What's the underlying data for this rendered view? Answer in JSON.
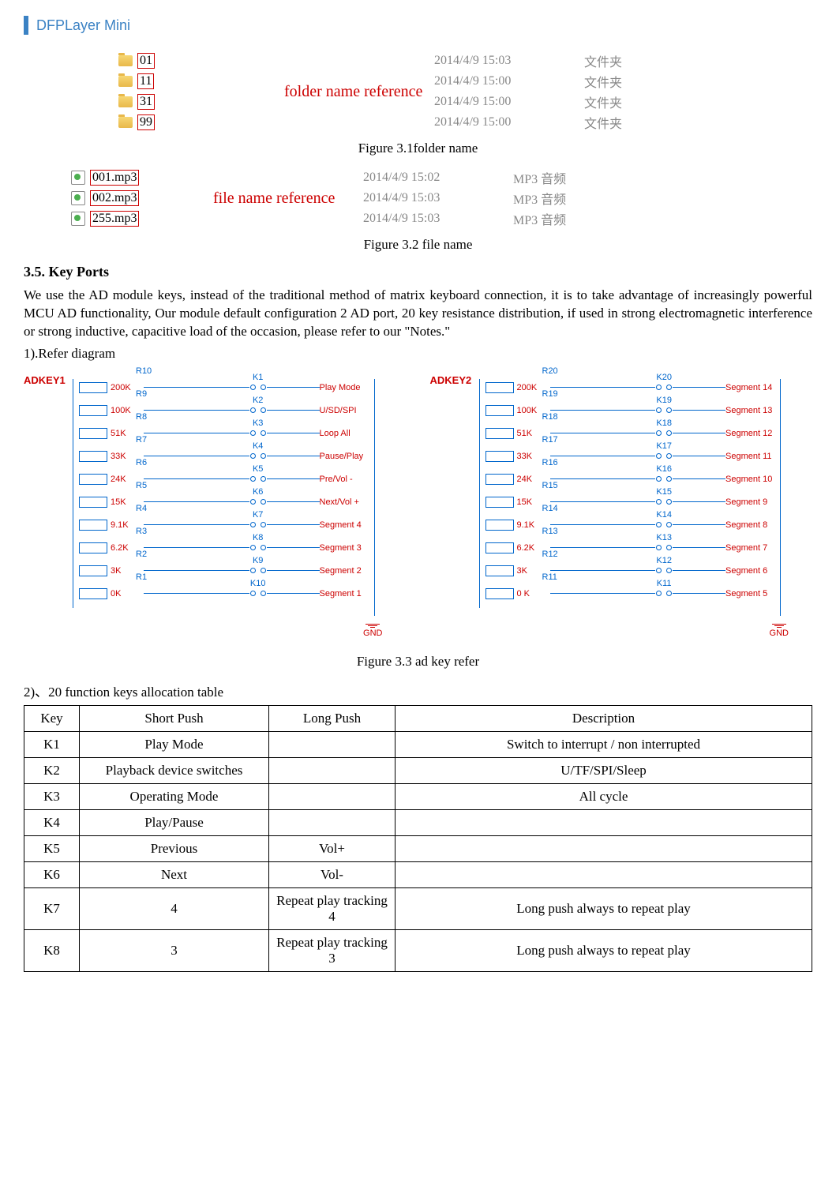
{
  "header": {
    "title": "DFPLayer Mini"
  },
  "folders": {
    "label": "folder name reference",
    "rows": [
      {
        "name": "01",
        "date": "2014/4/9 15:03",
        "type": "文件夹"
      },
      {
        "name": "11",
        "date": "2014/4/9 15:00",
        "type": "文件夹"
      },
      {
        "name": "31",
        "date": "2014/4/9 15:00",
        "type": "文件夹"
      },
      {
        "name": "99",
        "date": "2014/4/9 15:00",
        "type": "文件夹"
      }
    ],
    "caption": "Figure 3.1folder name"
  },
  "files": {
    "label": "file name reference",
    "rows": [
      {
        "name": "001.mp3",
        "date": "2014/4/9 15:02",
        "type": "MP3 音频"
      },
      {
        "name": "002.mp3",
        "date": "2014/4/9 15:03",
        "type": "MP3 音频"
      },
      {
        "name": "255.mp3",
        "date": "2014/4/9 15:03",
        "type": "MP3 音频"
      }
    ],
    "caption": "Figure 3.2 file name"
  },
  "section": {
    "heading": "3.5. Key Ports",
    "para": "We use the AD module keys, instead of the traditional method of matrix keyboard connection, it is to take advantage of increasingly powerful MCU AD functionality, Our module default configuration 2 AD port, 20 key resistance distribution, if used in strong electromagnetic interference or strong inductive, capacitive load of the occasion, please refer to our \"Notes.\"",
    "sub1": "1).Refer diagram"
  },
  "diagram": {
    "caption": "Figure 3.3 ad key refer",
    "gnd": "GND",
    "left": {
      "title": "ADKEY1",
      "rows": [
        {
          "r": "R10",
          "val": "200K",
          "k": "K1",
          "func": "Play Mode"
        },
        {
          "r": "R9",
          "val": "100K",
          "k": "K2",
          "func": "U/SD/SPI"
        },
        {
          "r": "R8",
          "val": "51K",
          "k": "K3",
          "func": "Loop All"
        },
        {
          "r": "R7",
          "val": "33K",
          "k": "K4",
          "func": "Pause/Play"
        },
        {
          "r": "R6",
          "val": "24K",
          "k": "K5",
          "func": "Pre/Vol -"
        },
        {
          "r": "R5",
          "val": "15K",
          "k": "K6",
          "func": "Next/Vol +"
        },
        {
          "r": "R4",
          "val": "9.1K",
          "k": "K7",
          "func": "Segment 4"
        },
        {
          "r": "R3",
          "val": "6.2K",
          "k": "K8",
          "func": "Segment 3"
        },
        {
          "r": "R2",
          "val": "3K",
          "k": "K9",
          "func": "Segment 2"
        },
        {
          "r": "R1",
          "val": "0K",
          "k": "K10",
          "func": "Segment 1"
        }
      ]
    },
    "right": {
      "title": "ADKEY2",
      "rows": [
        {
          "r": "R20",
          "val": "200K",
          "k": "K20",
          "func": "Segment 14"
        },
        {
          "r": "R19",
          "val": "100K",
          "k": "K19",
          "func": "Segment 13"
        },
        {
          "r": "R18",
          "val": "51K",
          "k": "K18",
          "func": "Segment 12"
        },
        {
          "r": "R17",
          "val": "33K",
          "k": "K17",
          "func": "Segment 11"
        },
        {
          "r": "R16",
          "val": "24K",
          "k": "K16",
          "func": "Segment 10"
        },
        {
          "r": "R15",
          "val": "15K",
          "k": "K15",
          "func": "Segment 9"
        },
        {
          "r": "R14",
          "val": "9.1K",
          "k": "K14",
          "func": "Segment 8"
        },
        {
          "r": "R13",
          "val": "6.2K",
          "k": "K13",
          "func": "Segment 7"
        },
        {
          "r": "R12",
          "val": "3K",
          "k": "K12",
          "func": "Segment 6"
        },
        {
          "r": "R11",
          "val": "0 K",
          "k": "K11",
          "func": "Segment 5"
        }
      ]
    }
  },
  "table": {
    "title": "2)、20 function keys allocation table",
    "headers": [
      "Key",
      "Short Push",
      "Long Push",
      "Description"
    ],
    "rows": [
      {
        "c0": "K1",
        "c1": "Play Mode",
        "c2": "",
        "c3": "Switch to interrupt / non interrupted"
      },
      {
        "c0": "K2",
        "c1": "Playback device switches",
        "c2": "",
        "c3": "U/TF/SPI/Sleep"
      },
      {
        "c0": "K3",
        "c1": "Operating Mode",
        "c2": "",
        "c3": "All cycle"
      },
      {
        "c0": "K4",
        "c1": "Play/Pause",
        "c2": "",
        "c3": ""
      },
      {
        "c0": "K5",
        "c1": "Previous",
        "c2": "Vol+",
        "c3": ""
      },
      {
        "c0": "K6",
        "c1": "Next",
        "c2": "Vol-",
        "c3": ""
      },
      {
        "c0": "K7",
        "c1": "4",
        "c2": "Repeat play tracking 4",
        "c3": "Long push always to repeat play"
      },
      {
        "c0": "K8",
        "c1": "3",
        "c2": "Repeat play tracking 3",
        "c3": "Long push always to repeat play"
      }
    ]
  }
}
